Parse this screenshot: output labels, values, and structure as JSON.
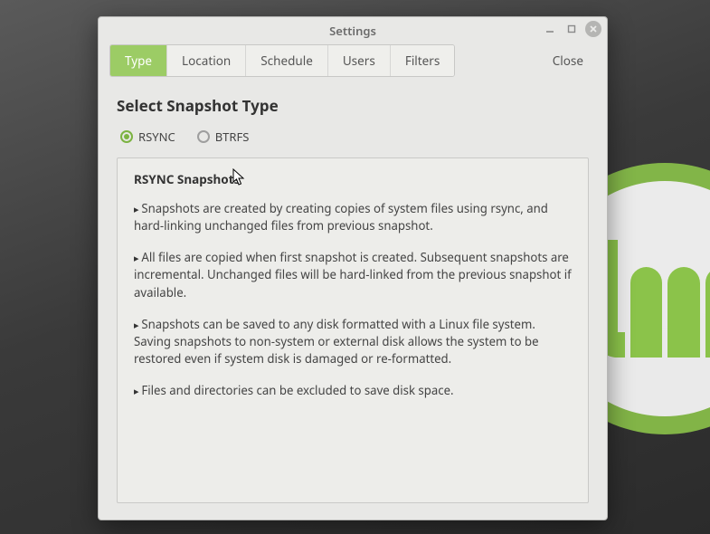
{
  "window": {
    "title": "Settings",
    "close_label": "Close"
  },
  "tabs": [
    {
      "label": "Type",
      "active": true
    },
    {
      "label": "Location",
      "active": false
    },
    {
      "label": "Schedule",
      "active": false
    },
    {
      "label": "Users",
      "active": false
    },
    {
      "label": "Filters",
      "active": false
    }
  ],
  "section_title": "Select Snapshot Type",
  "radios": [
    {
      "label": "RSYNC",
      "selected": true
    },
    {
      "label": "BTRFS",
      "selected": false
    }
  ],
  "info": {
    "title": "RSYNC Snapshots",
    "points": [
      "Snapshots are created by creating copies of system files using rsync, and hard-linking unchanged files from previous snapshot.",
      "All files are copied when first snapshot is created. Subsequent snapshots are incremental. Unchanged files will be hard-linked from the previous snapshot if available.",
      "Snapshots can be saved to any disk formatted with a Linux file system. Saving snapshots to non-system or external disk allows the system to be restored even if system disk is damaged or re-formatted.",
      "Files and directories can be excluded to save disk space."
    ]
  }
}
